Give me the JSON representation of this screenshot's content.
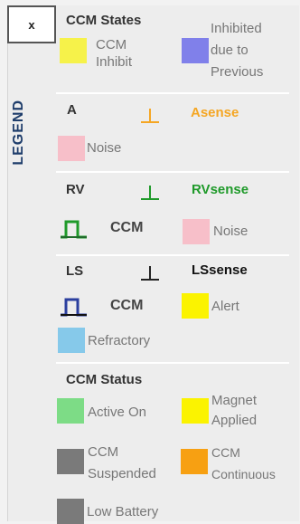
{
  "close_label": "x",
  "legend_title": "LEGEND",
  "ccm_states": {
    "title": "CCM States",
    "ccm_inhibit": "CCM\nInhibit",
    "inhibited_previous": "Inhibited\ndue to\nPrevious"
  },
  "atrial": {
    "label": "A",
    "sense": "Asense",
    "noise": "Noise"
  },
  "rv": {
    "label": "RV",
    "sense": "RVsense",
    "ccm": "CCM",
    "noise": "Noise"
  },
  "ls": {
    "label": "LS",
    "sense": "LSsense",
    "ccm": "CCM",
    "alert": "Alert",
    "refractory": "Refractory"
  },
  "ccm_status": {
    "title": "CCM Status",
    "active_on": "Active On",
    "magnet_applied": "Magnet\nApplied",
    "ccm_suspended": "CCM\nSuspended",
    "ccm_continuous": "CCM\nContinuous",
    "low_battery": "Low Battery"
  },
  "colors": {
    "yellow": "#f6f24a",
    "blue_purple": "#8080ea",
    "pink": "#f7bfc9",
    "orange": "#f5a623",
    "green": "#1f9a2a",
    "light_green": "#7ddc86",
    "light_blue": "#86c9ea",
    "gray": "#7a7a7a",
    "orange_box": "#f7a012",
    "bright_yellow": "#fbf300"
  }
}
